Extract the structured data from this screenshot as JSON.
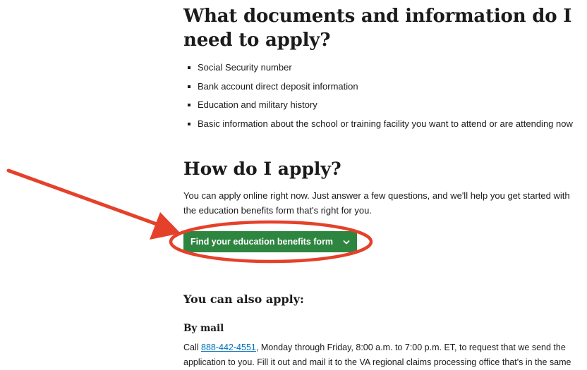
{
  "documents": {
    "heading": "What documents and information do I need to apply?",
    "items": [
      "Social Security number",
      "Bank account direct deposit information",
      "Education and military history",
      "Basic information about the school or training facility you want to attend or are attending now"
    ]
  },
  "how_to_apply": {
    "heading": "How do I apply?",
    "intro": "You can apply online right now. Just answer a few questions, and we'll help you get started with the education benefits form that's right for you.",
    "button_label": "Find your education benefits form",
    "button_icon": "chevron-down-icon"
  },
  "also_apply": {
    "heading": "You can also apply:",
    "by_mail": {
      "heading": "By mail",
      "text_before": "Call ",
      "phone": "888-442-4551",
      "text_after": ", Monday through Friday, 8:00 a.m. to 7:00 p.m. ET, to request that we send the application to you. Fill it out and mail it to the VA regional claims processing office that's in the same"
    }
  },
  "annotation": {
    "color": "#e5412a",
    "shapes": [
      "arrow",
      "ellipse"
    ]
  }
}
